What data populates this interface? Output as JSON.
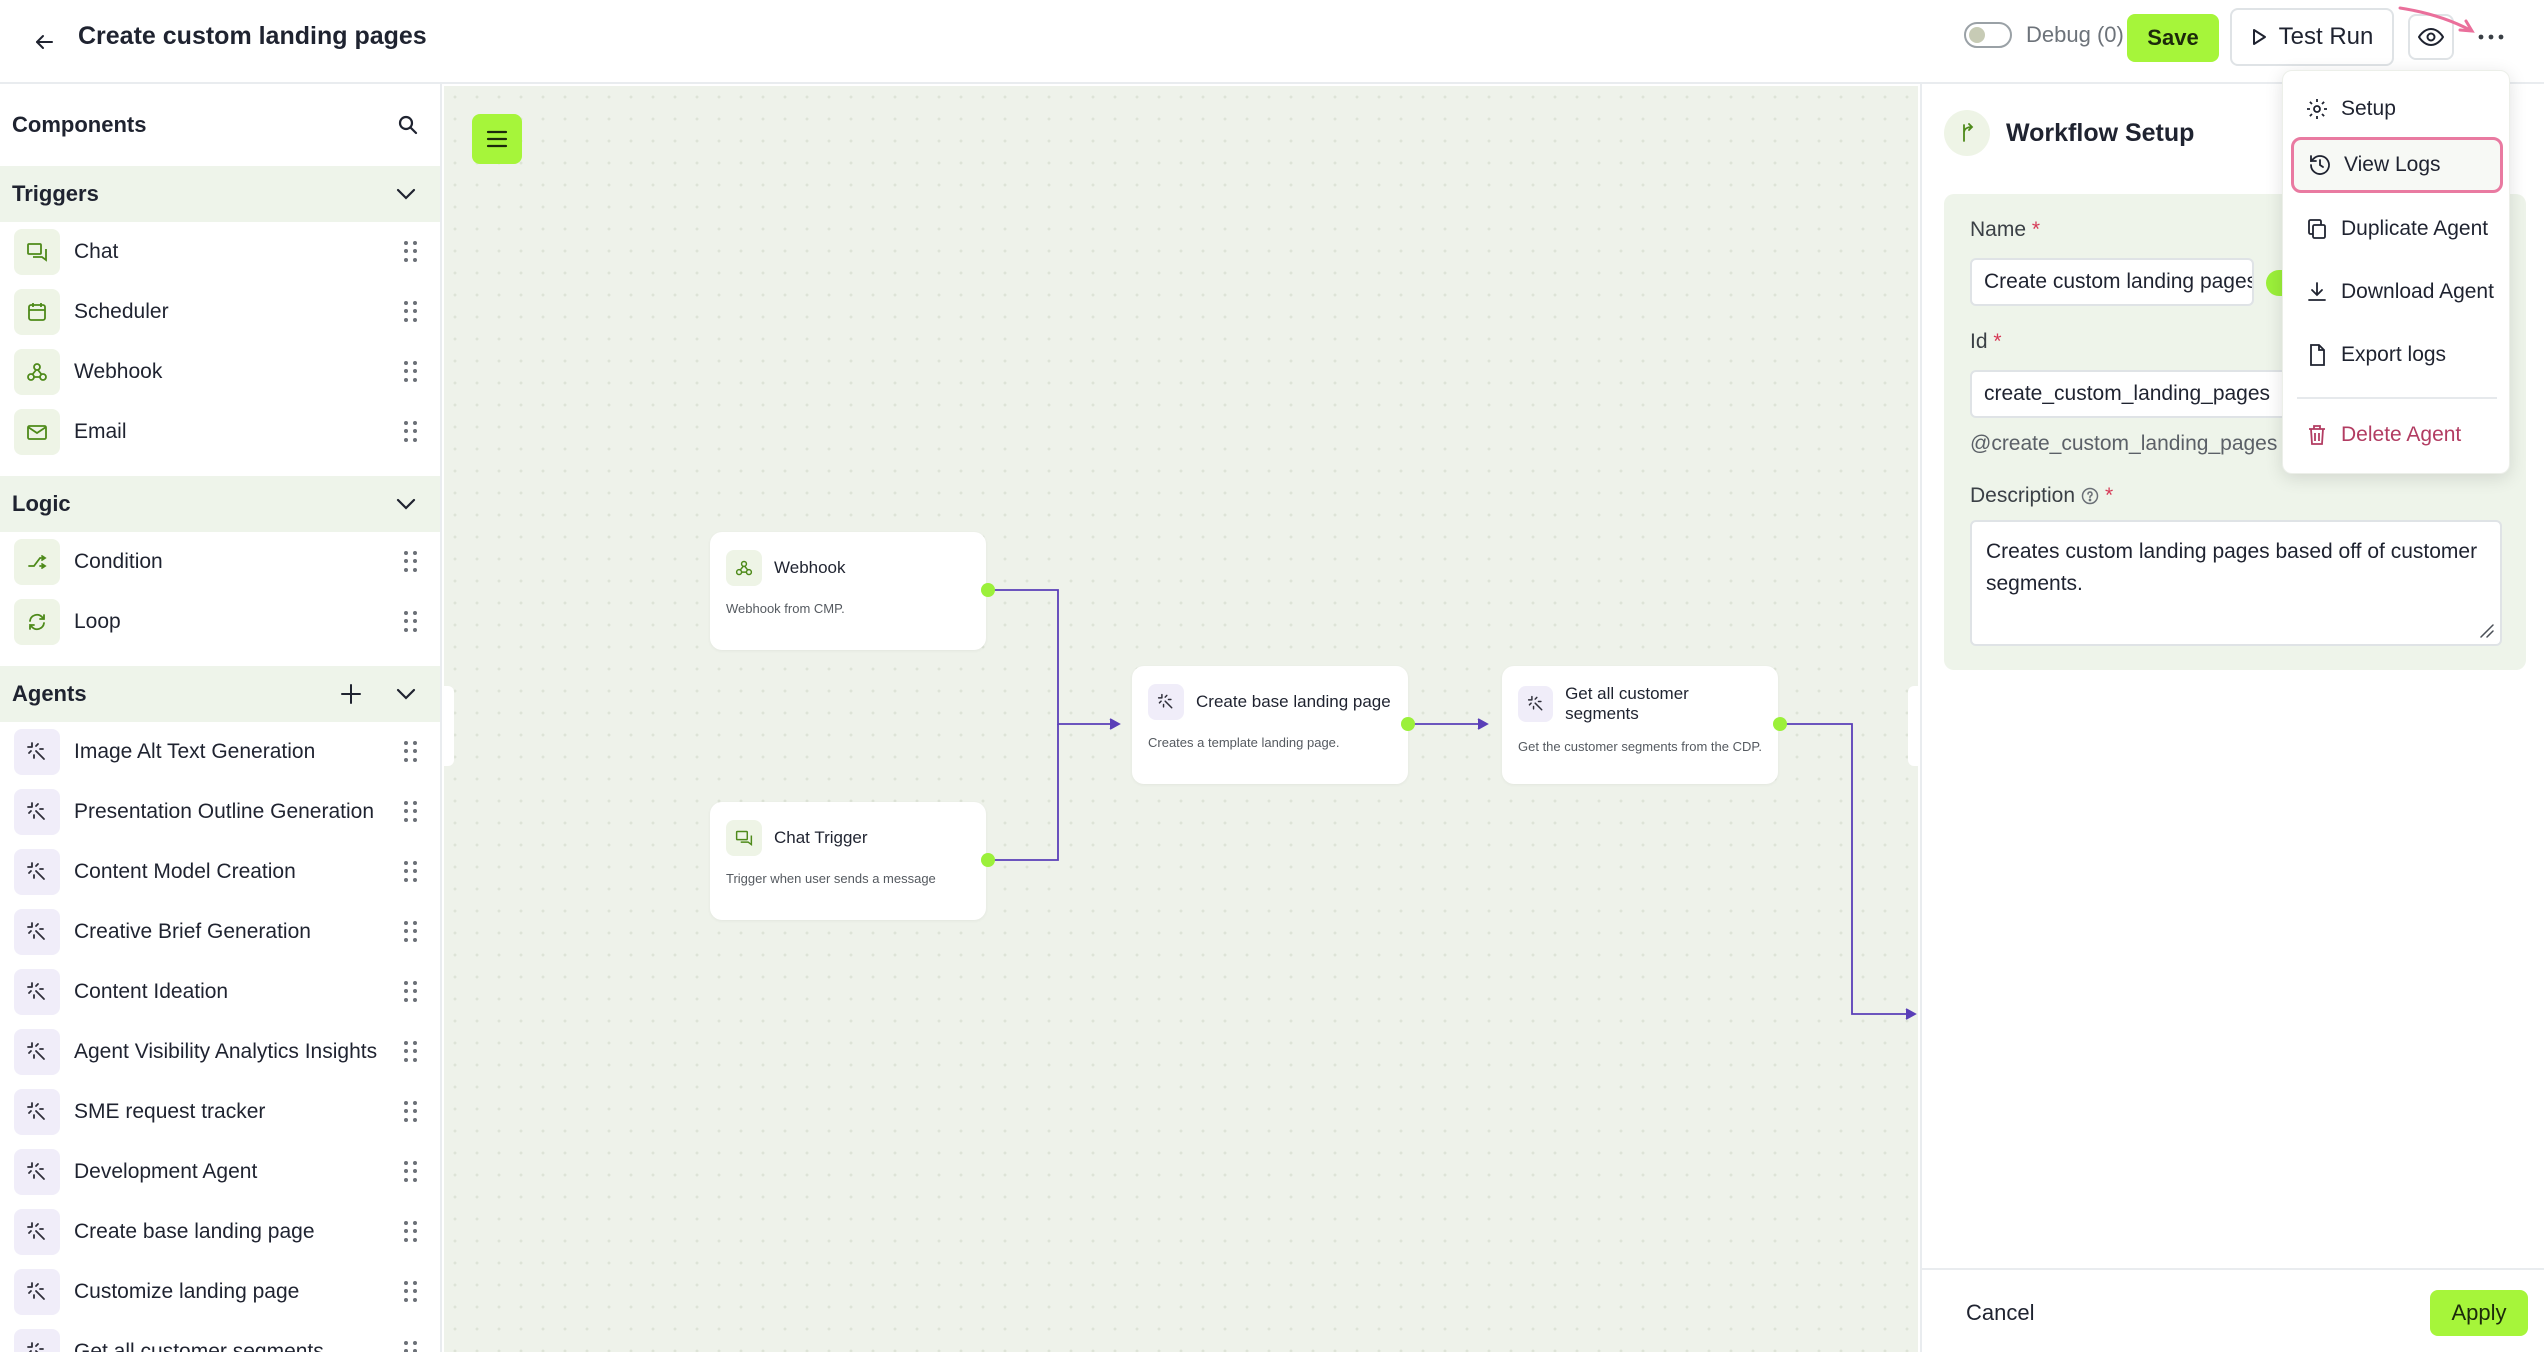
{
  "header": {
    "title": "Create custom landing pages",
    "debug_label": "Debug (0)",
    "save_label": "Save",
    "test_run_label": "Test Run"
  },
  "sidebar": {
    "title": "Components",
    "sections": {
      "triggers": {
        "title": "Triggers",
        "items": [
          {
            "label": "Chat",
            "icon": "chat-icon"
          },
          {
            "label": "Scheduler",
            "icon": "calendar-icon"
          },
          {
            "label": "Webhook",
            "icon": "webhook-icon"
          },
          {
            "label": "Email",
            "icon": "mail-icon"
          }
        ]
      },
      "logic": {
        "title": "Logic",
        "items": [
          {
            "label": "Condition",
            "icon": "branch-icon"
          },
          {
            "label": "Loop",
            "icon": "loop-icon"
          }
        ]
      },
      "agents": {
        "title": "Agents",
        "items": [
          {
            "label": "Image Alt Text Generation"
          },
          {
            "label": "Presentation Outline Generation"
          },
          {
            "label": "Content Model Creation"
          },
          {
            "label": "Creative Brief Generation"
          },
          {
            "label": "Content Ideation"
          },
          {
            "label": "Agent Visibility Analytics Insights"
          },
          {
            "label": "SME request tracker"
          },
          {
            "label": "Development Agent"
          },
          {
            "label": "Create base landing page"
          },
          {
            "label": "Customize landing page"
          },
          {
            "label": "Get all customer segments"
          }
        ]
      }
    }
  },
  "canvas": {
    "nodes": [
      {
        "title": "Webhook",
        "desc": "Webhook from CMP."
      },
      {
        "title": "Chat Trigger",
        "desc": "Trigger when user sends a message"
      },
      {
        "title": "Create base landing page",
        "desc": "Creates a template landing page."
      },
      {
        "title": "Get all customer segments",
        "desc": "Get the customer segments from the CDP."
      }
    ]
  },
  "panel": {
    "title": "Workflow Setup",
    "name_label": "Name",
    "name_value": "Create custom landing pages",
    "id_label": "Id",
    "id_value": "create_custom_landing_pages",
    "id_hint": "@create_custom_landing_pages",
    "description_label": "Description",
    "description_value": "Creates custom landing pages based off of customer segments.",
    "cancel_label": "Cancel",
    "apply_label": "Apply"
  },
  "dropdown": {
    "items": [
      {
        "label": "Setup",
        "icon": "gear-icon"
      },
      {
        "label": "View Logs",
        "icon": "history-icon",
        "highlighted": true
      },
      {
        "label": "Duplicate Agent",
        "icon": "copy-icon"
      },
      {
        "label": "Download Agent",
        "icon": "download-icon"
      },
      {
        "label": "Export logs",
        "icon": "file-icon"
      },
      {
        "label": "Delete Agent",
        "icon": "trash-icon",
        "danger": true
      }
    ]
  },
  "colors": {
    "accent": "#a6f53a",
    "canvas_bg": "#eef2ea",
    "section_bg": "#eef4ea",
    "wire": "#5a3fb8",
    "highlight": "#e97aa1",
    "danger": "#b23c62"
  }
}
